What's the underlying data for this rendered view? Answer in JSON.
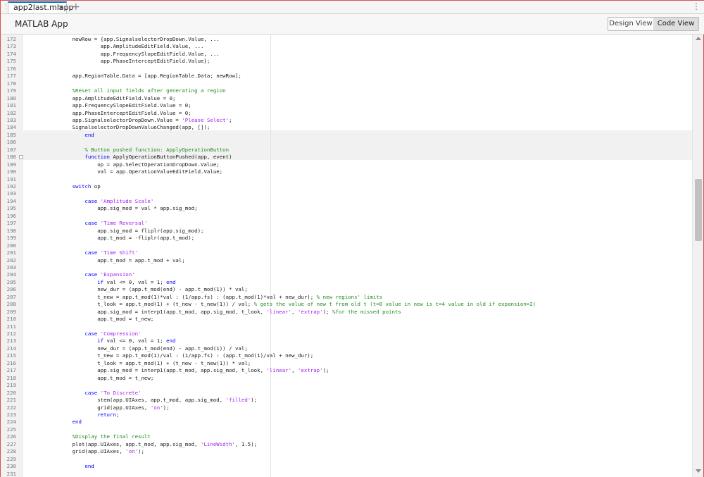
{
  "tab": {
    "title": "app2last.mlapp",
    "close": "×",
    "add": "+",
    "menu": "⋮",
    "handle": "⋮"
  },
  "header": {
    "title": "MATLAB App",
    "design_view": "Design View",
    "code_view": "Code View"
  },
  "editor": {
    "lines": [
      {
        "n": "172",
        "code": [
          {
            "t": "        newRow = {app.SignalselectorDropDown.Value, ..."
          }
        ]
      },
      {
        "n": "173",
        "code": [
          {
            "t": "                 app.AmplitudeEditField.Value, ..."
          }
        ]
      },
      {
        "n": "174",
        "code": [
          {
            "t": "                 app.FrequencySlopeEditField.Value, ..."
          }
        ]
      },
      {
        "n": "175",
        "code": [
          {
            "t": "                 app.PhaseInterceptEditField.Value};"
          }
        ]
      },
      {
        "n": "176",
        "code": []
      },
      {
        "n": "177",
        "code": [
          {
            "t": "        app.RegionTable.Data = [app.RegionTable.Data; newRow];"
          }
        ]
      },
      {
        "n": "178",
        "code": []
      },
      {
        "n": "179",
        "code": [
          {
            "t": "        %Reset all input fields after generating a region",
            "c": "cmt"
          }
        ]
      },
      {
        "n": "180",
        "code": [
          {
            "t": "        app.AmplitudeEditField.Value = 0;"
          }
        ]
      },
      {
        "n": "181",
        "code": [
          {
            "t": "        app.FrequencySlopeEditField.Value = 0;"
          }
        ]
      },
      {
        "n": "182",
        "code": [
          {
            "t": "        app.PhaseInterceptEditField.Value = 0;"
          }
        ]
      },
      {
        "n": "183",
        "code": [
          {
            "t": "        app.SignalselectorDropDown.Value = "
          },
          {
            "t": "'Please Select'",
            "c": "str"
          },
          {
            "t": ";"
          }
        ]
      },
      {
        "n": "184",
        "code": [
          {
            "t": "        SignalselectorDropDownValueChanged(app, []);"
          }
        ]
      },
      {
        "n": "185",
        "code": [
          {
            "t": "            "
          },
          {
            "t": "end",
            "c": "kw"
          }
        ]
      },
      {
        "n": "186",
        "code": []
      },
      {
        "n": "187",
        "code": [
          {
            "t": "            % Button pushed function: ApplyOperationButton",
            "c": "cmt"
          }
        ]
      },
      {
        "n": "188",
        "code": [
          {
            "t": "            "
          },
          {
            "t": "function",
            "c": "kw"
          },
          {
            "t": " ApplyOperationButtonPushed(app, event)"
          }
        ],
        "fold": true
      },
      {
        "n": "189",
        "code": [
          {
            "t": "                op = app.SelectOperationDropDown.Value;"
          }
        ]
      },
      {
        "n": "190",
        "code": [
          {
            "t": "                val = app.OperationValueEditField.Value;"
          }
        ]
      },
      {
        "n": "191",
        "code": []
      },
      {
        "n": "192",
        "code": [
          {
            "t": "        "
          },
          {
            "t": "switch",
            "c": "kw"
          },
          {
            "t": " op"
          }
        ]
      },
      {
        "n": "193",
        "code": []
      },
      {
        "n": "194",
        "code": [
          {
            "t": "            "
          },
          {
            "t": "case",
            "c": "kw"
          },
          {
            "t": " "
          },
          {
            "t": "'Amplitude Scale'",
            "c": "str"
          }
        ]
      },
      {
        "n": "195",
        "code": [
          {
            "t": "                app.sig_mod = val * app.sig_mod;"
          }
        ]
      },
      {
        "n": "196",
        "code": []
      },
      {
        "n": "197",
        "code": [
          {
            "t": "            "
          },
          {
            "t": "case",
            "c": "kw"
          },
          {
            "t": " "
          },
          {
            "t": "'Time Reversal'",
            "c": "str"
          }
        ]
      },
      {
        "n": "198",
        "code": [
          {
            "t": "                app.sig_mod = fliplr(app.sig_mod);"
          }
        ]
      },
      {
        "n": "199",
        "code": [
          {
            "t": "                app.t_mod = -fliplr(app.t_mod);"
          }
        ]
      },
      {
        "n": "200",
        "code": []
      },
      {
        "n": "201",
        "code": [
          {
            "t": "            "
          },
          {
            "t": "case",
            "c": "kw"
          },
          {
            "t": " "
          },
          {
            "t": "'Time Shift'",
            "c": "str"
          }
        ]
      },
      {
        "n": "202",
        "code": [
          {
            "t": "                app.t_mod = app.t_mod + val;"
          }
        ]
      },
      {
        "n": "203",
        "code": []
      },
      {
        "n": "204",
        "code": [
          {
            "t": "            "
          },
          {
            "t": "case",
            "c": "kw"
          },
          {
            "t": " "
          },
          {
            "t": "'Expansion'",
            "c": "str"
          }
        ]
      },
      {
        "n": "205",
        "code": [
          {
            "t": "                "
          },
          {
            "t": "if",
            "c": "kw"
          },
          {
            "t": " val <= 0, val = 1; "
          },
          {
            "t": "end",
            "c": "kw"
          }
        ]
      },
      {
        "n": "206",
        "code": [
          {
            "t": "                new_dur = (app.t_mod(end) - app.t_mod(1)) * val;"
          }
        ]
      },
      {
        "n": "207",
        "code": [
          {
            "t": "                t_new = app.t_mod(1)*val : (1/app.fs) : (app.t_mod(1)*val + new_dur); "
          },
          {
            "t": "% new regions' limits",
            "c": "cmt"
          }
        ]
      },
      {
        "n": "208",
        "code": [
          {
            "t": "                t_look = app.t_mod(1) + (t_new - t_new(1)) / val; "
          },
          {
            "t": "% gets the value of new t from old t (t=8 value in new is t=4 value in old if expansion=2)",
            "c": "cmt"
          }
        ]
      },
      {
        "n": "209",
        "code": [
          {
            "t": "                app.sig_mod = interp1(app.t_mod, app.sig_mod, t_look, "
          },
          {
            "t": "'linear'",
            "c": "str"
          },
          {
            "t": ", "
          },
          {
            "t": "'extrap'",
            "c": "str"
          },
          {
            "t": "); "
          },
          {
            "t": "%for the missed points",
            "c": "cmt"
          }
        ]
      },
      {
        "n": "210",
        "code": [
          {
            "t": "                app.t_mod = t_new;"
          }
        ]
      },
      {
        "n": "211",
        "code": []
      },
      {
        "n": "212",
        "code": [
          {
            "t": "            "
          },
          {
            "t": "case",
            "c": "kw"
          },
          {
            "t": " "
          },
          {
            "t": "'Compression'",
            "c": "str"
          }
        ]
      },
      {
        "n": "213",
        "code": [
          {
            "t": "                "
          },
          {
            "t": "if",
            "c": "kw"
          },
          {
            "t": " val <= 0, val = 1; "
          },
          {
            "t": "end",
            "c": "kw"
          }
        ]
      },
      {
        "n": "214",
        "code": [
          {
            "t": "                new_dur = (app.t_mod(end) - app.t_mod(1)) / val;"
          }
        ]
      },
      {
        "n": "215",
        "code": [
          {
            "t": "                t_new = app.t_mod(1)/val : (1/app.fs) : (app.t_mod(1)/val + new_dur);"
          }
        ]
      },
      {
        "n": "216",
        "code": [
          {
            "t": "                t_look = app.t_mod(1) + (t_new - t_new(1)) * val;"
          }
        ]
      },
      {
        "n": "217",
        "code": [
          {
            "t": "                app.sig_mod = interp1(app.t_mod, app.sig_mod, t_look, "
          },
          {
            "t": "'linear'",
            "c": "str"
          },
          {
            "t": ", "
          },
          {
            "t": "'extrap'",
            "c": "str"
          },
          {
            "t": ");"
          }
        ]
      },
      {
        "n": "218",
        "code": [
          {
            "t": "                app.t_mod = t_new;"
          }
        ]
      },
      {
        "n": "219",
        "code": []
      },
      {
        "n": "220",
        "code": [
          {
            "t": "            "
          },
          {
            "t": "case",
            "c": "kw"
          },
          {
            "t": " "
          },
          {
            "t": "'To Discrete'",
            "c": "str"
          }
        ]
      },
      {
        "n": "221",
        "code": [
          {
            "t": "                stem(app.UIAxes, app.t_mod, app.sig_mod, "
          },
          {
            "t": "'filled'",
            "c": "str"
          },
          {
            "t": ");"
          }
        ]
      },
      {
        "n": "222",
        "code": [
          {
            "t": "                grid(app.UIAxes, "
          },
          {
            "t": "'on'",
            "c": "str"
          },
          {
            "t": ");"
          }
        ]
      },
      {
        "n": "223",
        "code": [
          {
            "t": "                "
          },
          {
            "t": "return",
            "c": "kw"
          },
          {
            "t": ";"
          }
        ]
      },
      {
        "n": "224",
        "code": [
          {
            "t": "        "
          },
          {
            "t": "end",
            "c": "kw"
          }
        ]
      },
      {
        "n": "225",
        "code": []
      },
      {
        "n": "226",
        "code": [
          {
            "t": "        %Display the final result",
            "c": "cmt"
          }
        ]
      },
      {
        "n": "227",
        "code": [
          {
            "t": "        plot(app.UIAxes, app.t_mod, app.sig_mod, "
          },
          {
            "t": "'LineWidth'",
            "c": "str"
          },
          {
            "t": ", 1.5);"
          }
        ]
      },
      {
        "n": "228",
        "code": [
          {
            "t": "        grid(app.UIAxes, "
          },
          {
            "t": "'on'",
            "c": "str"
          },
          {
            "t": ");"
          }
        ]
      },
      {
        "n": "229",
        "code": []
      },
      {
        "n": "230",
        "code": [
          {
            "t": "            "
          },
          {
            "t": "end",
            "c": "kw"
          }
        ]
      },
      {
        "n": "231",
        "code": []
      }
    ]
  }
}
